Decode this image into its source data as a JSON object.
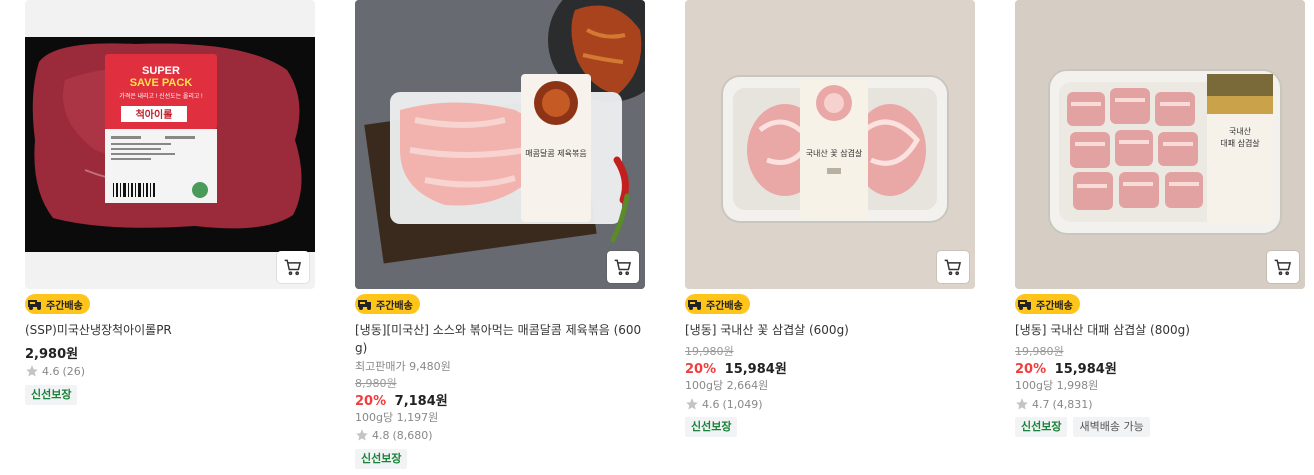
{
  "products": [
    {
      "badge": "주간배송",
      "title": "(SSP)미국산냉장척아이롤PR",
      "price": "2,980원",
      "rating": "4.6",
      "reviews": "(26)",
      "tags": [
        "신선보장"
      ],
      "image_text": {
        "banner1": "SUPER",
        "banner2": "SAVE PACK",
        "banner3": "가격은 내리고 ! 신선도는 올리고 !",
        "name": "척아이롤"
      }
    },
    {
      "badge": "주간배송",
      "title_line1": "[냉동][미국산] 소스와 볶아먹는 매콤달콤 제육볶음 (600",
      "title_line2": "g)",
      "best_price": "최고판매가 9,480원",
      "orig_price": "8,980원",
      "discount": "20%",
      "price": "7,184원",
      "unit_price": "100g당 1,197원",
      "rating": "4.8",
      "reviews": "(8,680)",
      "tags": [
        "신선보장"
      ],
      "image_text": {
        "label": "매콤달콤 제육볶음"
      }
    },
    {
      "badge": "주간배송",
      "title": "[냉동] 국내산 꽃 삼겹살 (600g)",
      "orig_price": "19,980원",
      "discount": "20%",
      "price": "15,984원",
      "unit_price": "100g당 2,664원",
      "rating": "4.6",
      "reviews": "(1,049)",
      "tags": [
        "신선보장"
      ],
      "image_text": {
        "label": "국내산 꽃 삼겹살"
      }
    },
    {
      "badge": "주간배송",
      "title": "[냉동] 국내산 대패 삼겹살 (800g)",
      "orig_price": "19,980원",
      "discount": "20%",
      "price": "15,984원",
      "unit_price": "100g당 1,998원",
      "rating": "4.7",
      "reviews": "(4,831)",
      "tags": [
        "신선보장",
        "새벽배송 가능"
      ],
      "image_text": {
        "label1": "국내산",
        "label2": "대패 삼겹살"
      }
    }
  ],
  "icons": {
    "cart": "cart-icon",
    "truck": "truck-icon",
    "star": "star-icon"
  },
  "colors": {
    "badge_bg": "#ffc51a",
    "discount": "#f03e3e",
    "fresh_tag": "#198238"
  }
}
